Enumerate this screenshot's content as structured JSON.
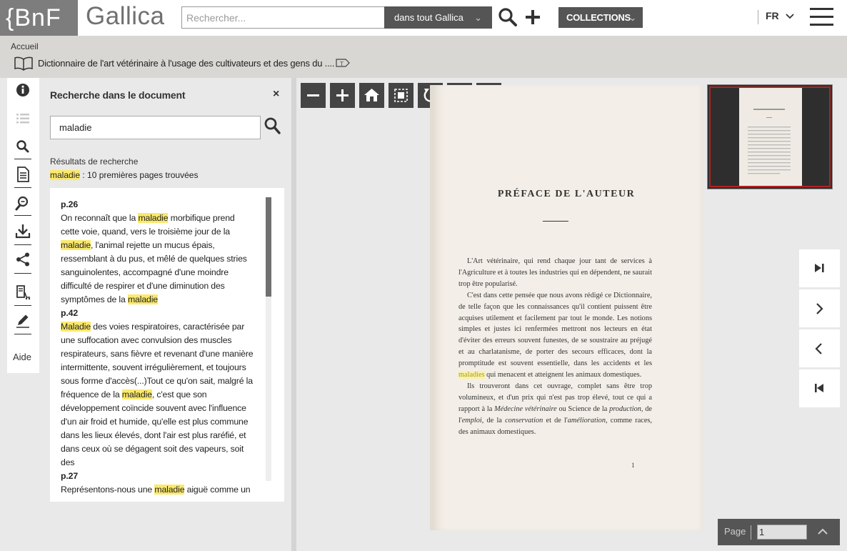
{
  "header": {
    "bnf_logo": "{BnF",
    "gallica_logo": "Gallica",
    "search_placeholder": "Rechercher...",
    "scope": "dans tout Gallica",
    "collections": "COLLECTIONS",
    "language": "FR"
  },
  "breadcrumb": {
    "home": "Accueil",
    "title": "Dictionnaire de l'art vétérinaire à l'usage des cultivateurs et des gens du ...."
  },
  "sidebar": {
    "help": "Aide"
  },
  "search_panel": {
    "title": "Recherche dans le document",
    "close": "×",
    "query": "maladie",
    "results_heading": "Résultats de recherche",
    "summary_term": "maladie",
    "summary_text": " : 10 premières pages trouvées",
    "results": [
      {
        "page": "p.26",
        "text": "On reconnaît que la <mark>maladie</mark> morbifique prend cette voie, quand, vers le troisième jour de la <mark>maladie</mark>, l'animal rejette un mucus épais, ressemblant à du pus, et mêlé de quelques stries sanguinolentes, accompagné d'une moindre difficulté de respirer et d'une diminution des symptômes de la <mark>maladie</mark>"
      },
      {
        "page": "p.42",
        "text": "<mark>Maladie</mark> des voies respiratoires, caractérisée par une suffocation avec convulsion des muscles respirateurs, sans fièvre et revenant d'une manière intermittente, souvent irrégulièrement, et toujours sous forme d'accès(...)Tout ce qu'on sait, malgré la fréquence de la <mark>maladie</mark>, c'est que son développement coïncide souvent avec l'influence d'un air froid et humide, qu'elle est plus commune dans les lieux élevés, dont l'air est plus raréfié, et dans ceux où se dégagent soit des vapeurs, soit des"
      },
      {
        "page": "p.27",
        "text": "Représentons-nous une <mark>maladie</mark> aiguë comme un"
      }
    ]
  },
  "document_page": {
    "heading": "PRÉFACE DE L'AUTEUR",
    "paragraphs": [
      "L'Art vétérinaire, qui rend chaque jour tant de services à l'Agriculture et à toutes les industries qui en dépendent, ne saurait trop être popularisé.",
      "C'est dans cette pensée que nous avons rédigé ce Dictionnaire, de telle façon que les connaissances qu'il contient puissent être acquises utilement et facilement par tout le monde. Les notions simples et justes ici renfermées mettront nos lecteurs en état d'éviter des erreurs souvent funestes, de se soustraire au préjugé et au charlatanisme, de porter des secours efficaces, dont la promptitude est souvent essentielle, dans les accidents et les <mark>maladies</mark> qui menacent et atteignent les animaux domestiques.",
      "Ils trouveront dans cet ouvrage, complet sans être trop volumineux, et d'un prix qui n'est pas trop élevé, tout ce qui a rapport à la <i>Médecine vétérinaire</i> ou Science de la <i>production</i>, de l'<i>emploi</i>, de la <i>conservation</i> et de l'<i>amélioration</i>, comme races, des animaux domestiques."
    ],
    "page_number": "1"
  },
  "pagination": {
    "label": "Page",
    "value": "1"
  },
  "colors": {
    "highlight": "#fbe96c",
    "dark_button": "#444444",
    "thumbnail_frame": "#b22222"
  }
}
